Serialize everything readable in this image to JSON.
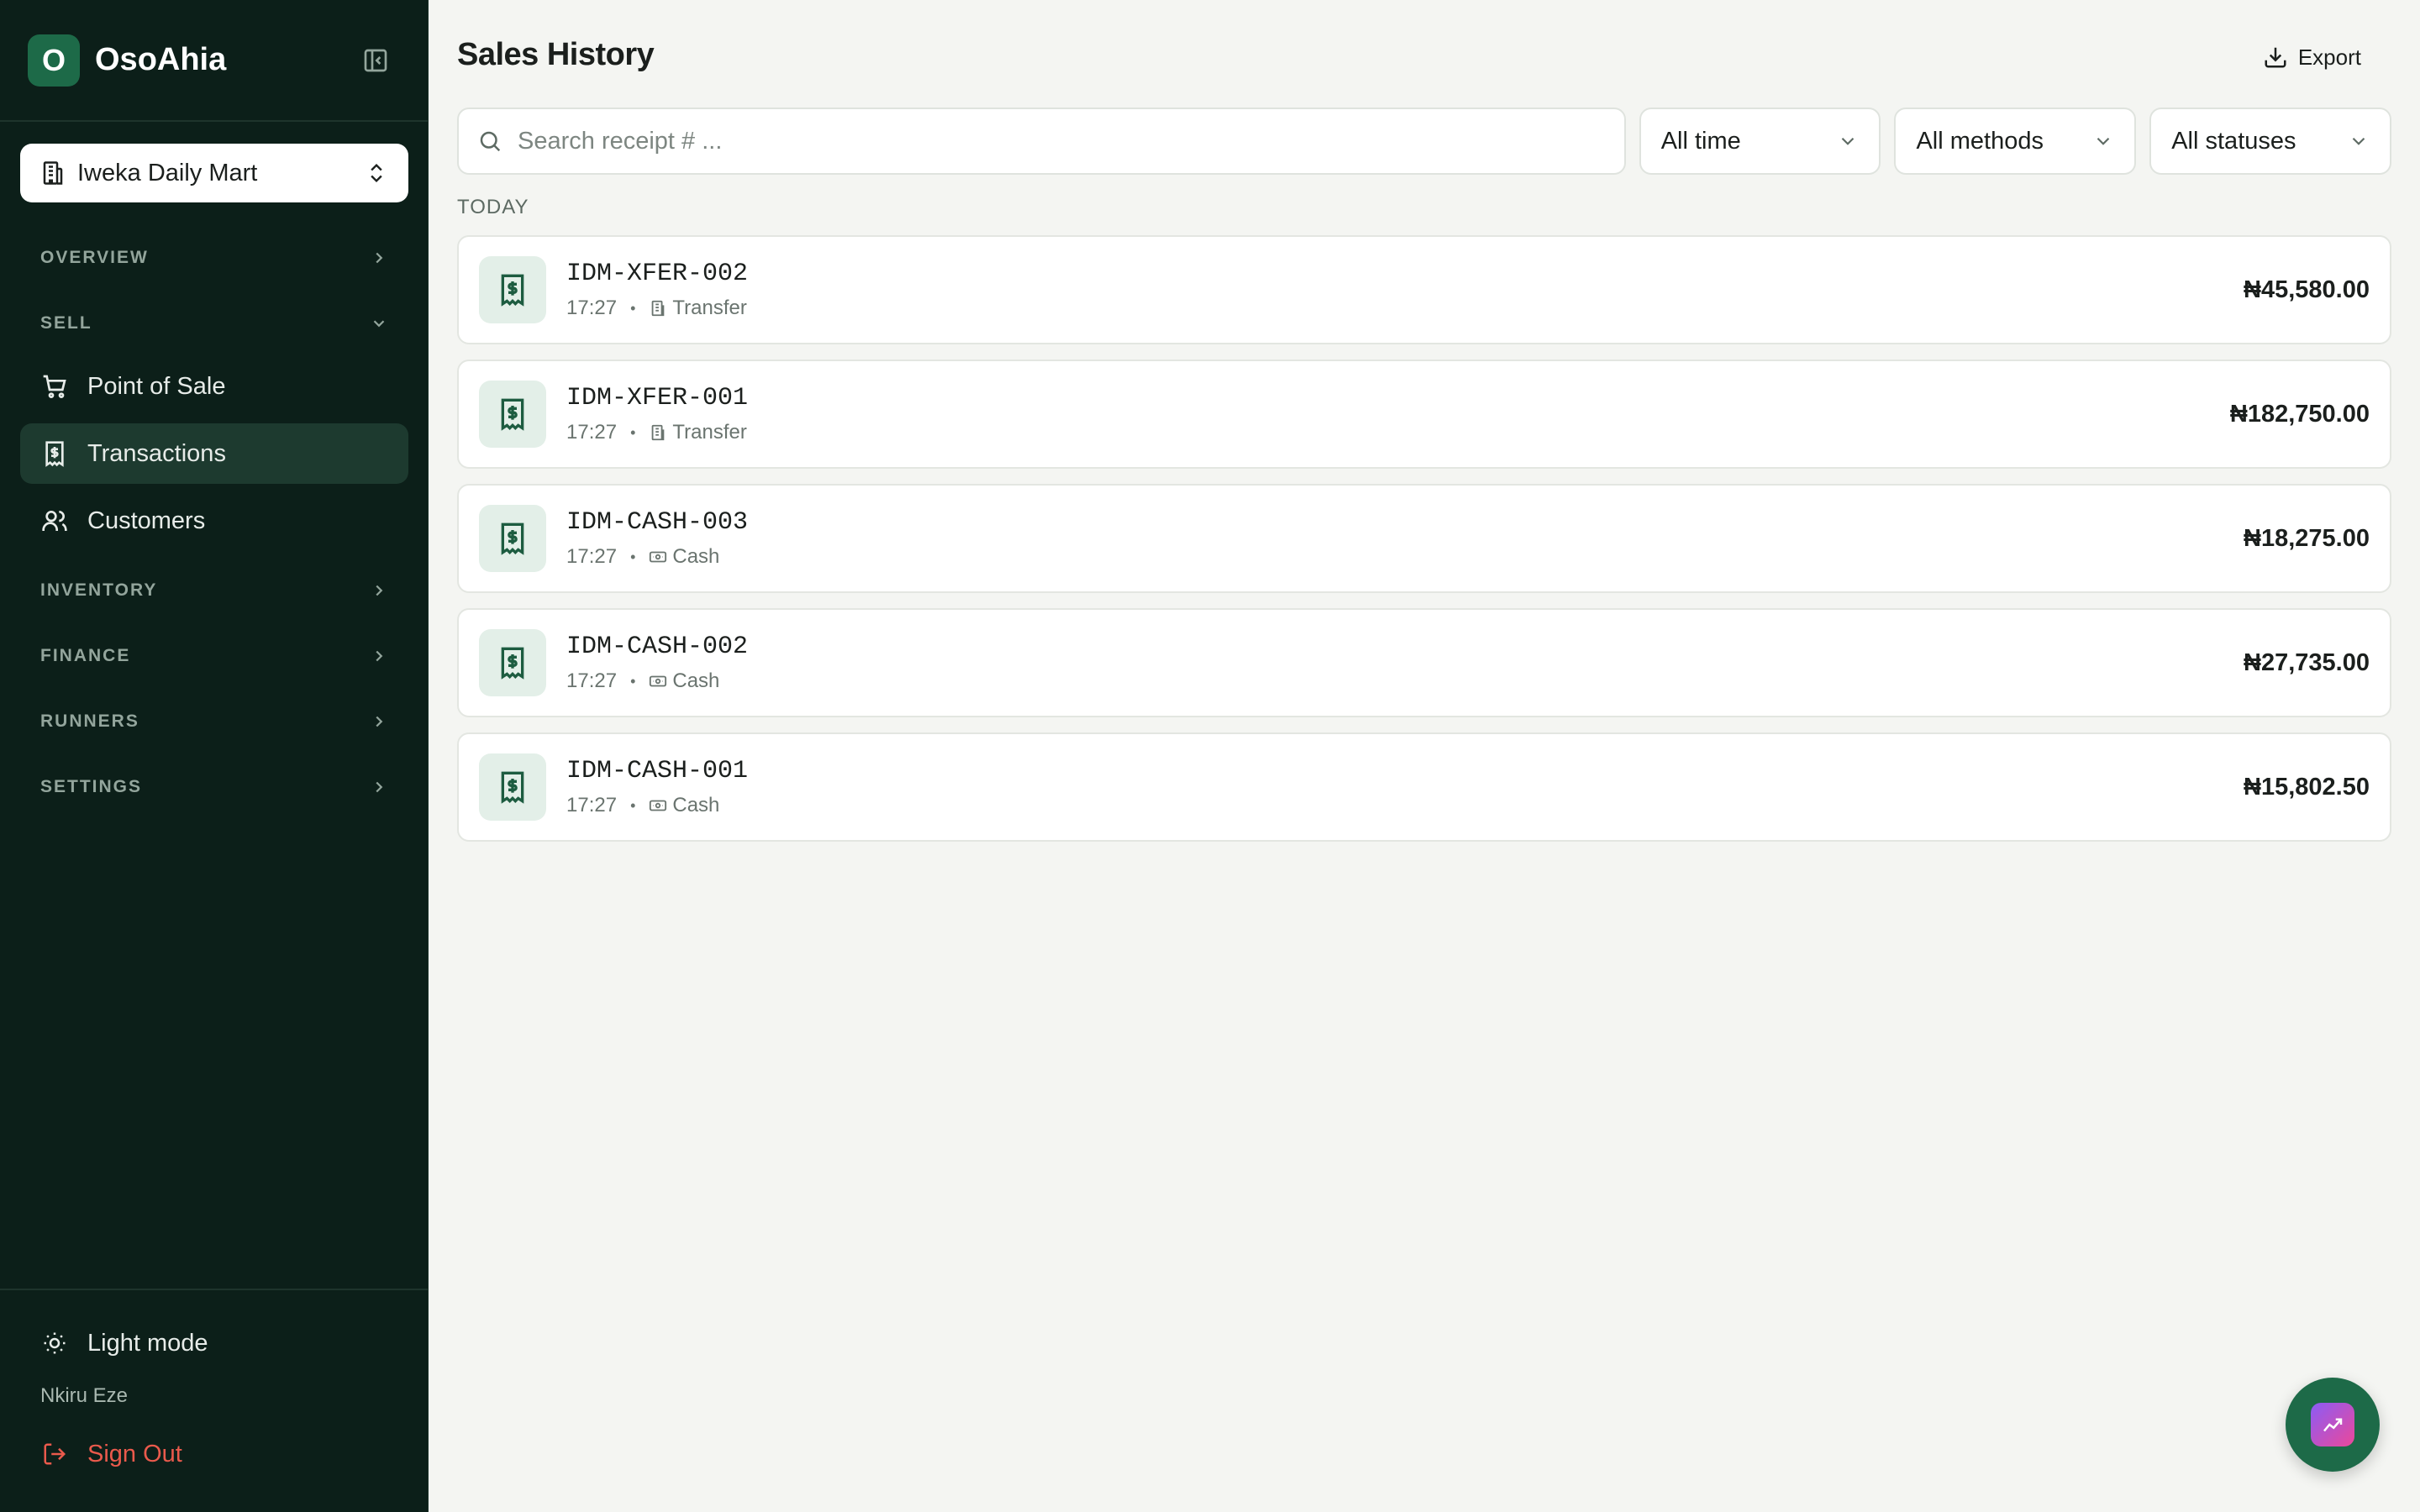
{
  "brand": {
    "initial": "O",
    "name": "OsoAhia"
  },
  "store": {
    "name": "Iweka Daily Mart"
  },
  "nav": {
    "overview": "OVERVIEW",
    "sell": "SELL",
    "sell_items": [
      {
        "label": "Point of Sale",
        "icon": "cart-icon"
      },
      {
        "label": "Transactions",
        "icon": "receipt-icon",
        "active": true
      },
      {
        "label": "Customers",
        "icon": "users-icon"
      }
    ],
    "inventory": "INVENTORY",
    "finance": "FINANCE",
    "runners": "RUNNERS",
    "settings": "SETTINGS"
  },
  "footer": {
    "theme_label": "Light mode",
    "user_name": "Nkiru Eze",
    "signout_label": "Sign Out"
  },
  "page": {
    "title": "Sales History",
    "export_label": "Export"
  },
  "filters": {
    "search_placeholder": "Search receipt # ...",
    "time": "All time",
    "method": "All methods",
    "status": "All statuses"
  },
  "group": {
    "label": "TODAY"
  },
  "transactions": [
    {
      "receipt": "IDM-XFER-002",
      "time": "17:27",
      "method": "Transfer",
      "amount": "₦45,580.00"
    },
    {
      "receipt": "IDM-XFER-001",
      "time": "17:27",
      "method": "Transfer",
      "amount": "₦182,750.00"
    },
    {
      "receipt": "IDM-CASH-003",
      "time": "17:27",
      "method": "Cash",
      "amount": "₦18,275.00"
    },
    {
      "receipt": "IDM-CASH-002",
      "time": "17:27",
      "method": "Cash",
      "amount": "₦27,735.00"
    },
    {
      "receipt": "IDM-CASH-001",
      "time": "17:27",
      "method": "Cash",
      "amount": "₦15,802.50"
    }
  ],
  "colors": {
    "sidebar_bg": "#0c1f19",
    "accent": "#1d6a48",
    "page_bg": "#f4f5f2",
    "danger": "#ea5a4c"
  }
}
